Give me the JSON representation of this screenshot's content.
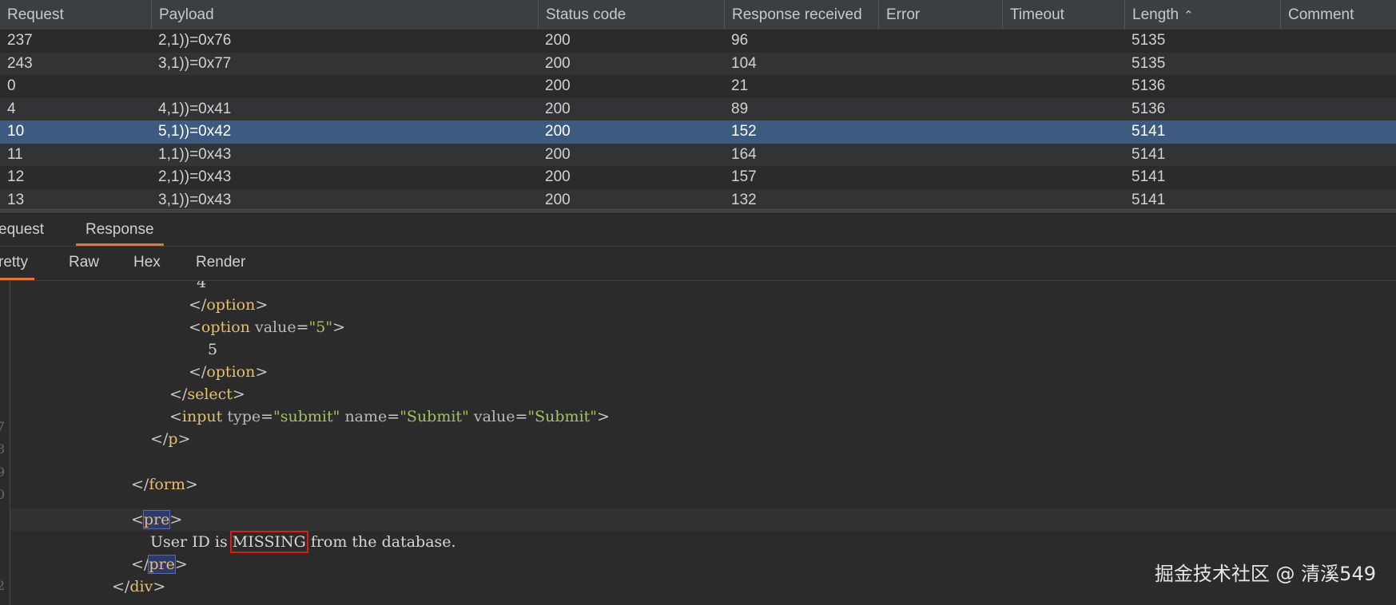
{
  "results_table": {
    "columns": [
      "Request",
      "Payload",
      "Status code",
      "Response received",
      "Error",
      "Timeout",
      "Length",
      "Comment"
    ],
    "sort_indicator": "^",
    "rows": [
      {
        "request": "237",
        "payload": "2,1))=0x76",
        "status": "200",
        "received": "96",
        "error": "",
        "timeout": "",
        "length": "5135",
        "comment": ""
      },
      {
        "request": "243",
        "payload": "3,1))=0x77",
        "status": "200",
        "received": "104",
        "error": "",
        "timeout": "",
        "length": "5135",
        "comment": ""
      },
      {
        "request": "0",
        "payload": "",
        "status": "200",
        "received": "21",
        "error": "",
        "timeout": "",
        "length": "5136",
        "comment": ""
      },
      {
        "request": "4",
        "payload": "4,1))=0x41",
        "status": "200",
        "received": "89",
        "error": "",
        "timeout": "",
        "length": "5136",
        "comment": ""
      },
      {
        "request": "10",
        "payload": "5,1))=0x42",
        "status": "200",
        "received": "152",
        "error": "",
        "timeout": "",
        "length": "5141",
        "comment": ""
      },
      {
        "request": "11",
        "payload": "1,1))=0x43",
        "status": "200",
        "received": "164",
        "error": "",
        "timeout": "",
        "length": "5141",
        "comment": ""
      },
      {
        "request": "12",
        "payload": "2,1))=0x43",
        "status": "200",
        "received": "157",
        "error": "",
        "timeout": "",
        "length": "5141",
        "comment": ""
      },
      {
        "request": "13",
        "payload": "3,1))=0x43",
        "status": "200",
        "received": "132",
        "error": "",
        "timeout": "",
        "length": "5141",
        "comment": ""
      }
    ],
    "selected_request": "10"
  },
  "message_tabs": {
    "request_label": "equest",
    "response_label": "Response"
  },
  "view_tabs": {
    "pretty_label": "retty",
    "raw_label": "Raw",
    "hex_label": "Hex",
    "render_label": "Render"
  },
  "editor": {
    "gutter_numbers": [
      "7",
      "8",
      "9",
      "0",
      "",
      "2"
    ],
    "code": {
      "l1_text": "4",
      "l2_tag": "option",
      "l3_tag": "option",
      "l3_attr": "value",
      "l3_val": "\"5\"",
      "l4_text": "5",
      "l5_tag": "option",
      "l6_tag": "select",
      "l7_tag": "input",
      "l7_a1": "type",
      "l7_v1": "\"submit\"",
      "l7_a2": "name",
      "l7_v2": "\"Submit\"",
      "l7_a3": "value",
      "l7_v3": "\"Submit\"",
      "l8_tag": "p",
      "l10_tag": "form",
      "l11_tag": "pre",
      "l12_pre": "User ID is",
      "l12_highlight": "MISSING",
      "l12_post": "from the database.",
      "l13_tag": "pre",
      "l14_tag": "div"
    }
  },
  "watermark": "掘金技术社区 @ 清溪549",
  "colors": {
    "background": "#2b2b2b",
    "header": "#3c3f41",
    "selected_row": "#3d5a80",
    "tab_underline": "#e8743b",
    "tag": "#e8bf6a",
    "string": "#a5c261",
    "highlight_box": "#e0191d"
  }
}
